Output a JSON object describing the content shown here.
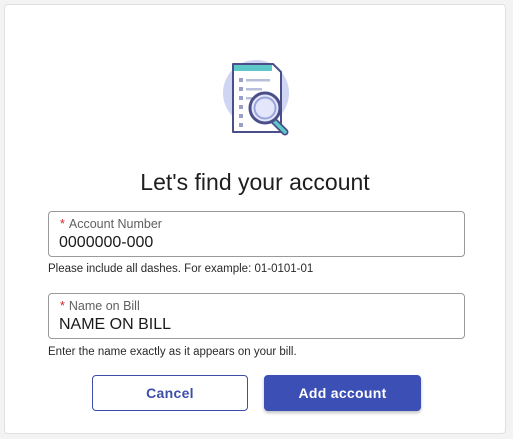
{
  "page": {
    "title": "Let's find your account"
  },
  "account_number": {
    "required_mark": "*",
    "label": "Account Number",
    "value": "0000000-000",
    "help": "Please include all dashes. For example: 01-0101-01"
  },
  "name_on_bill": {
    "required_mark": "*",
    "label": "Name on Bill",
    "value": "NAME ON BILL",
    "help": "Enter the name exactly as it appears on your bill."
  },
  "actions": {
    "cancel_label": "Cancel",
    "add_label": "Add account"
  },
  "icons": {
    "illustration": "document-search-icon"
  },
  "colors": {
    "primary": "#3c4fb4",
    "required": "#c62828",
    "illustration_bg": "#cfd5f3",
    "illustration_accent": "#5cc8c8"
  }
}
